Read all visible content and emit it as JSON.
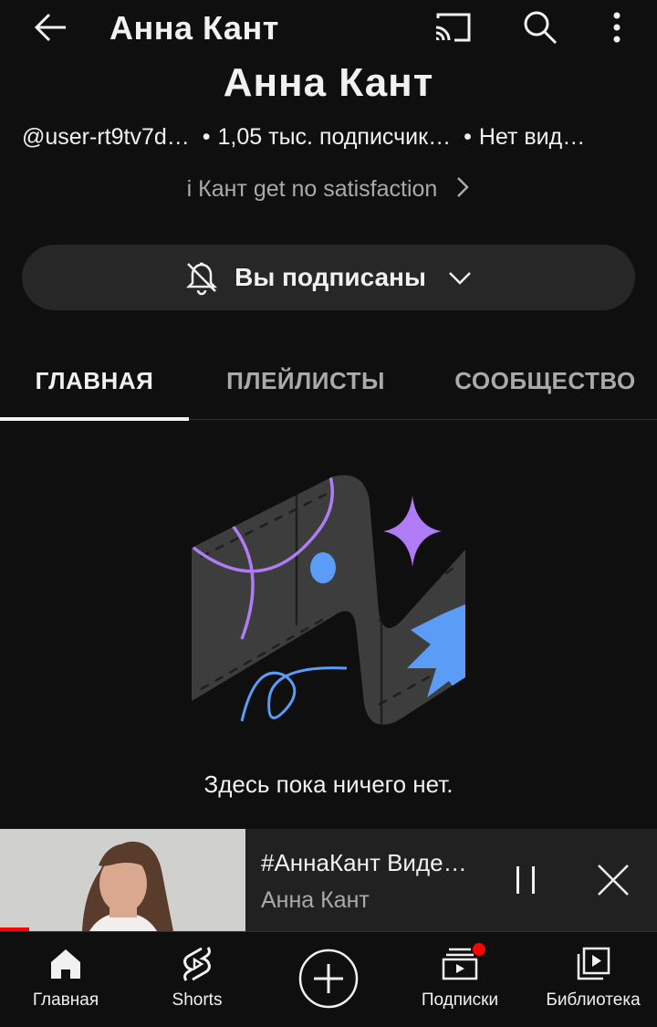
{
  "topbar": {
    "title": "Анна Кант",
    "icons": [
      "back-arrow-icon",
      "cast-icon",
      "search-icon",
      "more-vert-icon"
    ]
  },
  "channel": {
    "name": "Анна Кант",
    "handle": "@user-rt9tv7d…",
    "subscribers": "1,05 тыс. подписчик…",
    "videos": "Нет вид…",
    "separator": "•",
    "description": "i Кант get no satisfaction"
  },
  "subscribe": {
    "label": "Вы подписаны",
    "icon": "bell-off-icon"
  },
  "tabs": [
    {
      "label": "ГЛАВНАЯ",
      "active": true
    },
    {
      "label": "ПЛЕЙЛИСТЫ",
      "active": false
    },
    {
      "label": "СООБЩЕСТВО",
      "active": false
    }
  ],
  "empty_state": {
    "message": "Здесь пока ничего нет."
  },
  "miniplayer": {
    "title": "#АннаКант Виде…",
    "channel": "Анна Кант",
    "progress": 0.12,
    "accent": "#ff0000"
  },
  "bottom_nav": [
    {
      "label": "Главная",
      "icon": "home-icon"
    },
    {
      "label": "Shorts",
      "icon": "shorts-icon"
    },
    {
      "label": "",
      "icon": "create-plus-icon"
    },
    {
      "label": "Подписки",
      "icon": "subscriptions-icon",
      "badge": true
    },
    {
      "label": "Библиотека",
      "icon": "library-icon"
    }
  ],
  "colors": {
    "background": "#0f0f0f",
    "surface": "#272727",
    "text": "#f1f1f1",
    "secondary_text": "#aaaaaa",
    "accent_red": "#ff0000",
    "illustration_purple": "#b07cf6",
    "illustration_blue": "#5b9cf6"
  }
}
